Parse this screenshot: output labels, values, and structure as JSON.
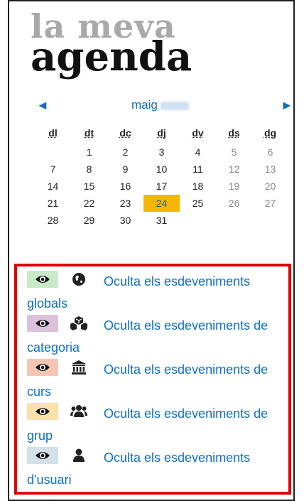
{
  "title": {
    "line1": "la meva",
    "line2": "agenda"
  },
  "calendar": {
    "prev": "◄",
    "next": "►",
    "month": "maig",
    "weekdays": [
      "dl",
      "dt",
      "dc",
      "dj",
      "dv",
      "ds",
      "dg"
    ],
    "weeks": [
      [
        "",
        "1",
        "2",
        "3",
        "4",
        "5",
        "6"
      ],
      [
        "7",
        "8",
        "9",
        "10",
        "11",
        "12",
        "13"
      ],
      [
        "14",
        "15",
        "16",
        "17",
        "18",
        "19",
        "20"
      ],
      [
        "21",
        "22",
        "23",
        "24",
        "25",
        "26",
        "27"
      ],
      [
        "28",
        "29",
        "30",
        "31",
        "",
        "",
        ""
      ]
    ],
    "today": "24"
  },
  "filters": [
    {
      "label": "Oculta els esdeveniments globals",
      "icon": "globe-icon",
      "color": "#c9e9c9"
    },
    {
      "label": "Oculta els esdeveniments de categoria",
      "icon": "cubes-icon",
      "color": "#dcc1dc"
    },
    {
      "label": "Oculta els esdeveniments de curs",
      "icon": "institution-icon",
      "color": "#f6c4b2"
    },
    {
      "label": "Oculta els esdeveniments de grup",
      "icon": "group-icon",
      "color": "#fbe0aa"
    },
    {
      "label": "Oculta els esdeveniments d'usuari",
      "icon": "user-icon",
      "color": "#d3e1e8"
    }
  ]
}
